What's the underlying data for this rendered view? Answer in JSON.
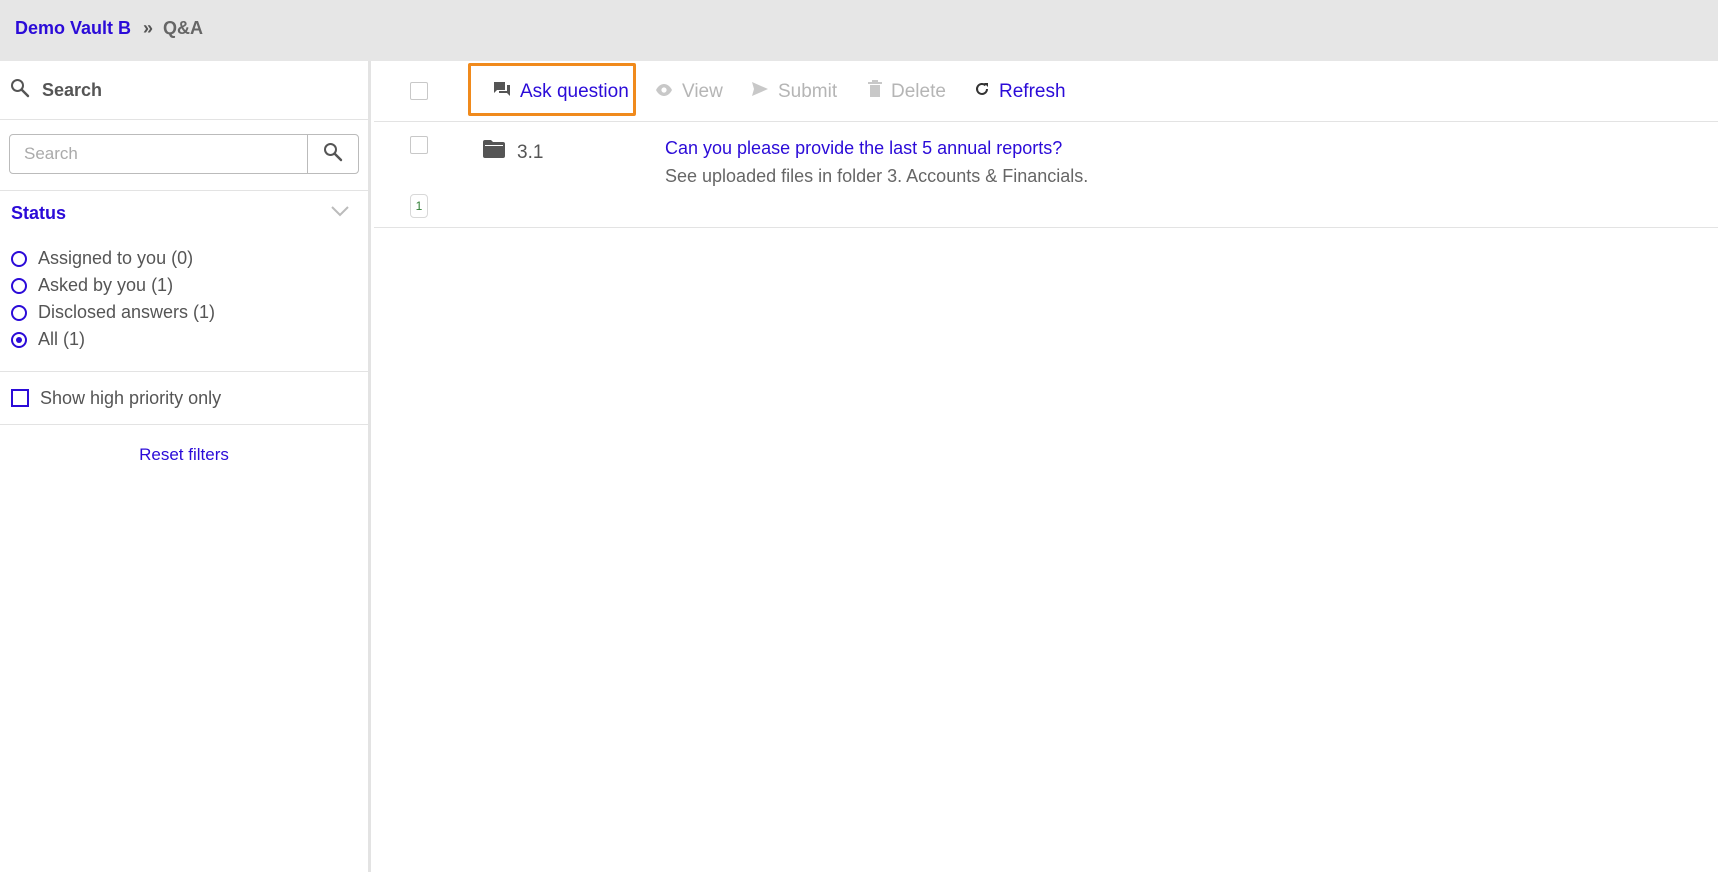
{
  "breadcrumb": {
    "root": "Demo Vault B",
    "separator": "»",
    "current": "Q&A"
  },
  "sidebar": {
    "search_title": "Search",
    "search_placeholder": "Search",
    "status_title": "Status",
    "status_options": [
      {
        "label": "Assigned to you (0)",
        "selected": false
      },
      {
        "label": "Asked by you (1)",
        "selected": false
      },
      {
        "label": "Disclosed answers (1)",
        "selected": false
      },
      {
        "label": "All (1)",
        "selected": true
      }
    ],
    "high_priority_label": "Show high priority only",
    "reset_label": "Reset filters"
  },
  "toolbar": {
    "ask_label": "Ask question",
    "view_label": "View",
    "submit_label": "Submit",
    "delete_label": "Delete",
    "refresh_label": "Refresh"
  },
  "questions": [
    {
      "ref": "3.1",
      "question": "Can you please provide the last 5 annual reports?",
      "answer": "See uploaded files in folder 3. Accounts & Financials.",
      "badge": "1"
    }
  ],
  "colors": {
    "accent": "#2b0bd8",
    "highlight": "#f08a1c",
    "topbar": "#e6e6e6",
    "disabled": "#b5b5b5"
  },
  "icons": {
    "search": "magnifier-icon",
    "ask": "chat-bubbles-icon",
    "view": "eye-icon",
    "submit": "send-icon",
    "delete": "trash-icon",
    "refresh": "refresh-icon",
    "folder": "folder-icon",
    "chevron": "chevron-down-icon"
  }
}
